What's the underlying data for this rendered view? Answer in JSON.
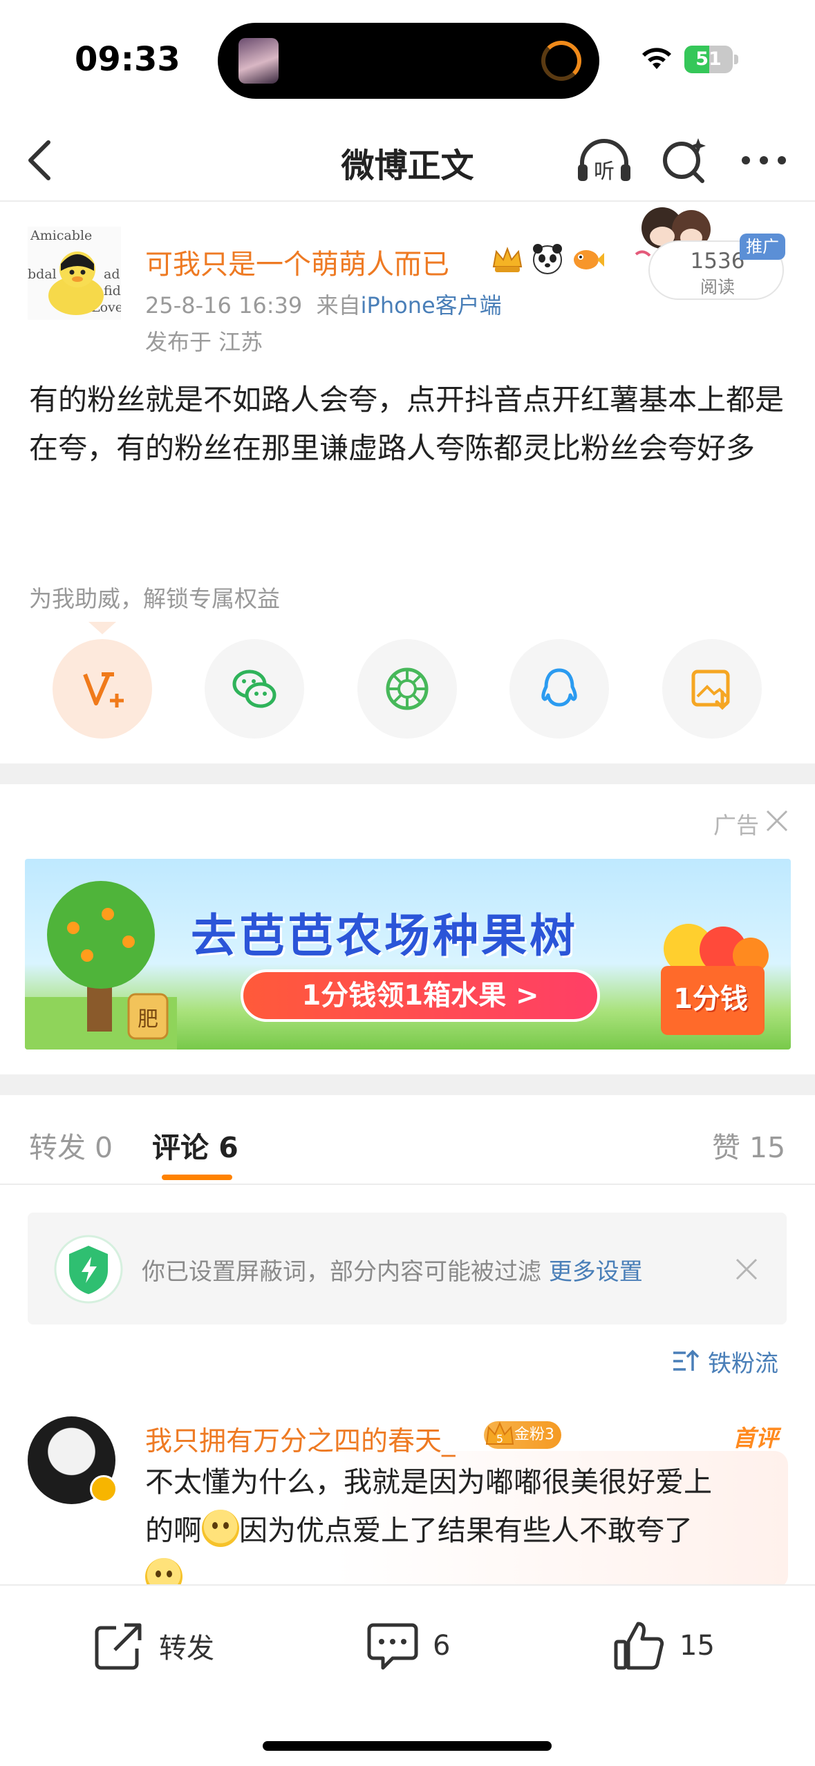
{
  "status_bar": {
    "time": "09:33",
    "battery_percent": 51,
    "battery_text": "51"
  },
  "nav": {
    "title": "微博正文",
    "listen_label": "听"
  },
  "post": {
    "username": "可我只是一个萌萌人而已",
    "meta_time": "25-8-16 16:39",
    "meta_from_prefix": "来自",
    "meta_source": "iPhone客户端",
    "location": "发布于 江苏",
    "read_count": "1536",
    "read_label": "阅读",
    "promo_tag": "推广",
    "body": "有的粉丝就是不如路人会夸，点开抖音点开红薯基本上都是在夸，有的粉丝在那里谦虚路人夸陈都灵比粉丝会夸好多",
    "avatar_text": [
      "Amicable",
      "bdal",
      "ad",
      "fid",
      "Love"
    ]
  },
  "support": {
    "text": "为我助威，解锁专属权益"
  },
  "share": [
    {
      "icon": "v-plus-icon",
      "color": "#f07a1a"
    },
    {
      "icon": "wechat-icon",
      "color": "#2fb35a"
    },
    {
      "icon": "moments-icon",
      "color": "#47b85a"
    },
    {
      "icon": "qq-icon",
      "color": "#2b9bf0"
    },
    {
      "icon": "save-image-icon",
      "color": "#f5a623"
    }
  ],
  "ad": {
    "label": "广告",
    "title": "去芭芭农场种果树",
    "cta": "1分钱领1箱水果 >",
    "box_text": "1分钱",
    "tree_tag": "肥"
  },
  "tabs": {
    "repost": "转发 0",
    "comment": "评论 6",
    "like": "赞 15"
  },
  "notice": {
    "text": "你已设置屏蔽词，部分内容可能被过滤",
    "link": "更多设置"
  },
  "sort": {
    "label": "铁粉流"
  },
  "comment": {
    "name": "我只拥有万分之四的春天_",
    "fan_badge": "金粉3",
    "fan_level": "5",
    "first_tag": "首评",
    "body_line1": "不太懂为什么，我就是因为嘟嘟很美很好爱上",
    "body_line2a": "的啊",
    "body_line2b": "因为优点爱上了结果有些人不敢夸了"
  },
  "bottom_bar": {
    "repost_label": "转发",
    "comment_count": "6",
    "like_count": "15"
  },
  "colors": {
    "accent_orange": "#ff8200",
    "username_orange": "#ee7a23",
    "link_blue": "#4a7fb8"
  }
}
